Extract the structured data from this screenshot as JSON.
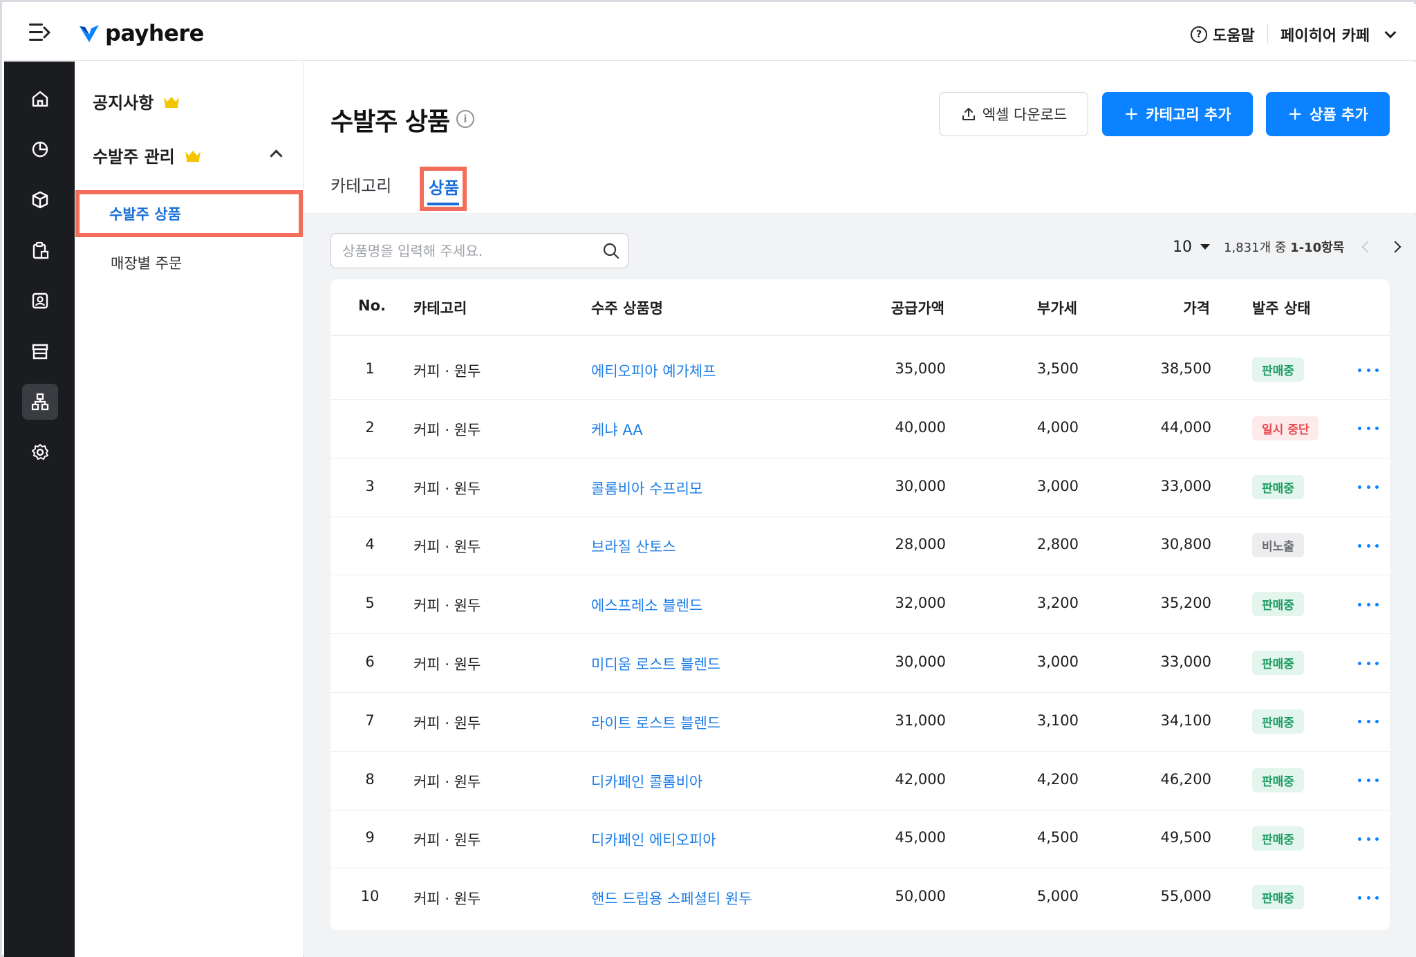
{
  "brand": {
    "logo_text": "payhere",
    "logo_color": "#0b82ff"
  },
  "topbar": {
    "help_label": "도움말",
    "store_name": "페이히어 카페"
  },
  "rail": {
    "items": [
      "home-icon",
      "chart-pie-icon",
      "box-icon",
      "clipboard-icon",
      "customer-icon",
      "store-icon",
      "org-chart-icon",
      "gear-icon"
    ],
    "active_index": 6
  },
  "subnav": {
    "notice": "공지사항",
    "order_mgmt": "수발주 관리",
    "active_item": "수발주 상품",
    "store_orders": "매장별 주문"
  },
  "header": {
    "title": "수발주 상품",
    "excel_button": "엑셀 다운로드",
    "add_category_button": "카테고리 추가",
    "add_product_button": "상품 추가",
    "tabs": [
      {
        "label": "카테고리"
      },
      {
        "label": "상품"
      }
    ],
    "active_tab": 1
  },
  "toolbar": {
    "search_placeholder": "상품명을 입력해 주세요.",
    "page_size": "10",
    "page_info_prefix": "1,831개 중 ",
    "page_info_range": "1-10항목"
  },
  "table": {
    "columns": {
      "no": "No.",
      "category": "카테고리",
      "name": "수주 상품명",
      "supply": "공급가액",
      "vat": "부가세",
      "price": "가격",
      "status": "발주 상태"
    },
    "rows": [
      {
        "no": "1",
        "category": "커피 · 원두",
        "name": "에티오피아 예가체프",
        "supply": "35,000",
        "vat": "3,500",
        "price": "38,500",
        "status": "판매중",
        "status_type": "sale"
      },
      {
        "no": "2",
        "category": "커피 · 원두",
        "name": "케냐 AA",
        "supply": "40,000",
        "vat": "4,000",
        "price": "44,000",
        "status": "일시 중단",
        "status_type": "pause"
      },
      {
        "no": "3",
        "category": "커피 · 원두",
        "name": "콜롬비아 수프리모",
        "supply": "30,000",
        "vat": "3,000",
        "price": "33,000",
        "status": "판매중",
        "status_type": "sale"
      },
      {
        "no": "4",
        "category": "커피 · 원두",
        "name": "브라질 산토스",
        "supply": "28,000",
        "vat": "2,800",
        "price": "30,800",
        "status": "비노출",
        "status_type": "hidden"
      },
      {
        "no": "5",
        "category": "커피 · 원두",
        "name": "에스프레소 블렌드",
        "supply": "32,000",
        "vat": "3,200",
        "price": "35,200",
        "status": "판매중",
        "status_type": "sale"
      },
      {
        "no": "6",
        "category": "커피 · 원두",
        "name": "미디움 로스트 블렌드",
        "supply": "30,000",
        "vat": "3,000",
        "price": "33,000",
        "status": "판매중",
        "status_type": "sale"
      },
      {
        "no": "7",
        "category": "커피 · 원두",
        "name": "라이트 로스트 블렌드",
        "supply": "31,000",
        "vat": "3,100",
        "price": "34,100",
        "status": "판매중",
        "status_type": "sale"
      },
      {
        "no": "8",
        "category": "커피 · 원두",
        "name": "디카페인 콜롬비아",
        "supply": "42,000",
        "vat": "4,200",
        "price": "46,200",
        "status": "판매중",
        "status_type": "sale"
      },
      {
        "no": "9",
        "category": "커피 · 원두",
        "name": "디카페인 에티오피아",
        "supply": "45,000",
        "vat": "4,500",
        "price": "49,500",
        "status": "판매중",
        "status_type": "sale"
      },
      {
        "no": "10",
        "category": "커피 · 원두",
        "name": "핸드 드립용 스페셜티 원두",
        "supply": "50,000",
        "vat": "5,000",
        "price": "55,000",
        "status": "판매중",
        "status_type": "sale"
      }
    ]
  },
  "colors": {
    "accent": "#0b82ff",
    "link": "#1a7ce8",
    "highlight": "#f26d5b",
    "rail_bg": "#1b1c20"
  }
}
